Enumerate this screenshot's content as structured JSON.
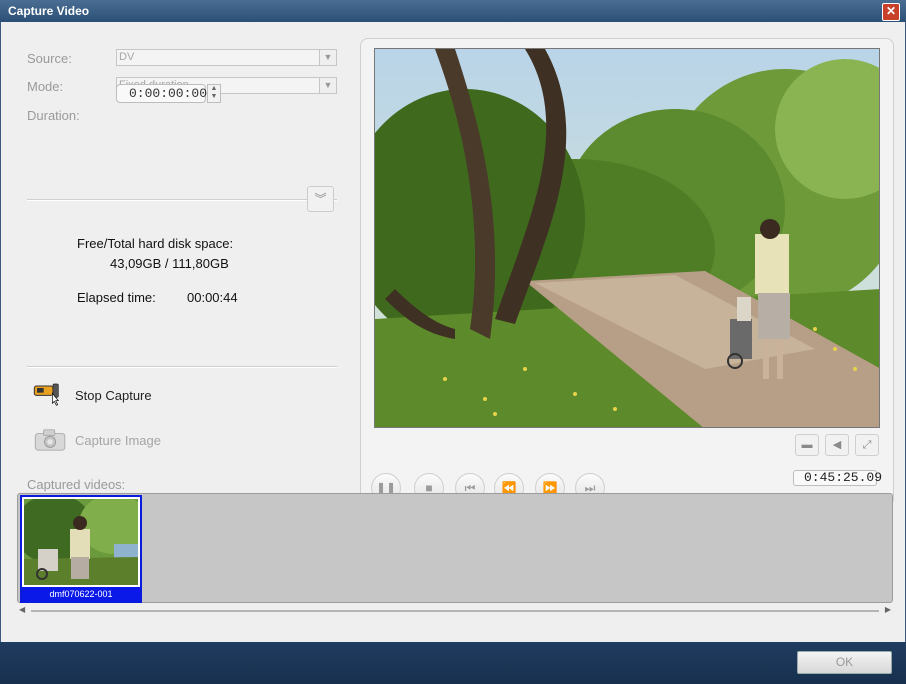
{
  "window": {
    "title": "Capture Video",
    "close_icon": "close-icon"
  },
  "form": {
    "source_label": "Source:",
    "source_value": "DV",
    "mode_label": "Mode:",
    "mode_value": "Fixed duration",
    "duration_label": "Duration:",
    "duration_value": "0:00:00:00"
  },
  "info": {
    "disk_label": "Free/Total hard disk space:",
    "disk_value": "43,09GB / 111,80GB",
    "elapsed_label": "Elapsed time:",
    "elapsed_value": "00:00:44"
  },
  "actions": {
    "stop_capture": "Stop Capture",
    "capture_image": "Capture Image"
  },
  "preview": {
    "timecode": "0:45:25.09",
    "controls": [
      "pause",
      "stop",
      "go-to-start",
      "rewind",
      "fast-forward",
      "go-to-end"
    ]
  },
  "captured": {
    "label": "Captured videos:",
    "items": [
      {
        "name": "dmf070622-001"
      }
    ]
  },
  "footer": {
    "ok_label": "OK"
  }
}
